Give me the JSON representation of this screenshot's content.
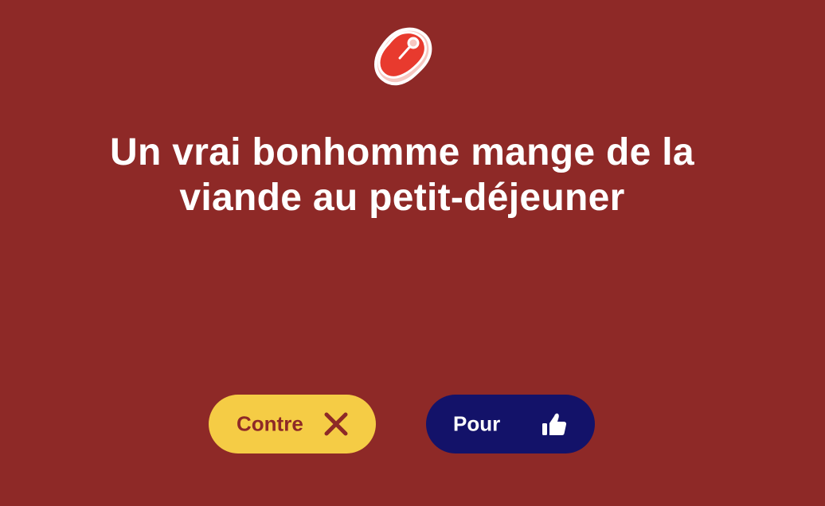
{
  "topic": {
    "icon": "meat-steak-icon",
    "statement": "Un vrai bonhomme mange de la viande au petit-déjeuner"
  },
  "actions": {
    "against_label": "Contre",
    "against_icon": "close-x-icon",
    "for_label": "Pour",
    "for_icon": "thumbs-up-icon"
  },
  "colors": {
    "background": "#8e2927",
    "against_button": "#f5cc45",
    "for_button": "#131269",
    "text": "#ffffff"
  }
}
